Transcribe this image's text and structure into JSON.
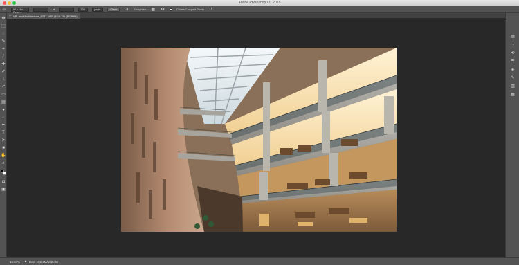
{
  "window": {
    "title": "Adobe Photoshop CC 2015"
  },
  "options_bar": {
    "ratio_preset": "W x H x Reso...",
    "width_value": "",
    "swap_glyph": "⇄",
    "resolution_value": "300",
    "resolution_unit": "px/in",
    "clear_label": "Clear",
    "straighten_label": "Straighten",
    "delete_cropped_label": "Delete Cropped Pixels"
  },
  "document_tab": {
    "label": "VPL and Architecture_6337.NEF @ 16.7% (RGB/8*)"
  },
  "status": {
    "zoom": "16.67%",
    "doc_info": "Doc: 102.4M/102.4M"
  },
  "tools": [
    "move-icon",
    "marquee-icon",
    "lasso-icon",
    "quick-select-icon",
    "crop-icon",
    "eyedropper-icon",
    "healing-icon",
    "brush-icon",
    "clone-stamp-icon",
    "history-brush-icon",
    "eraser-icon",
    "gradient-icon",
    "blur-icon",
    "dodge-icon",
    "pen-icon",
    "type-icon",
    "path-select-icon",
    "shape-icon",
    "hand-icon",
    "zoom-icon"
  ],
  "panel_icons": [
    "layers-icon",
    "adjustments-icon",
    "history-icon",
    "properties-icon",
    "channels-icon",
    "paths-icon",
    "styles-icon",
    "swatches-icon"
  ],
  "colors": {
    "canvas_bg": "#282828",
    "ui_gray": "#535353",
    "foreground_swatch": "#000000",
    "background_swatch": "#ffffff"
  }
}
